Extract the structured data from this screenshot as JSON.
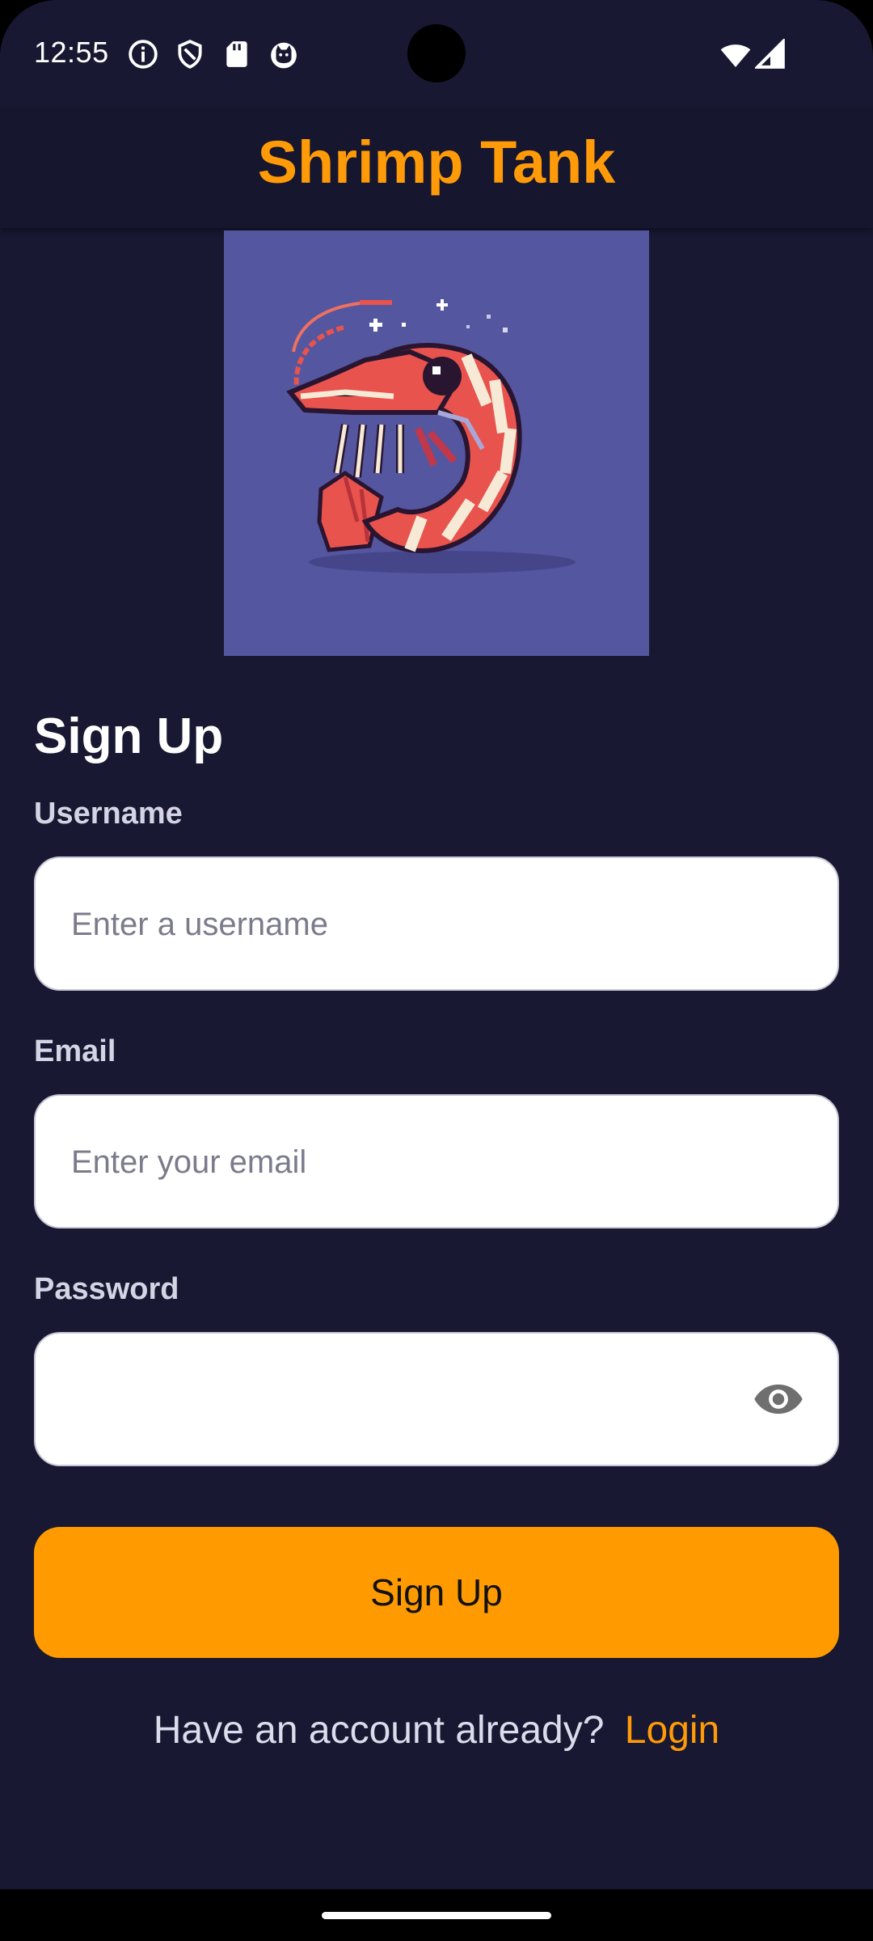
{
  "status_bar": {
    "time": "12:55",
    "icons": [
      "info-icon",
      "shield-icon",
      "sd-card-icon",
      "cat-icon",
      "wifi-icon",
      "signal-icon"
    ]
  },
  "app_bar": {
    "title": "Shrimp Tank"
  },
  "logo": {
    "icon": "shrimp-logo"
  },
  "form": {
    "heading": "Sign Up",
    "username": {
      "label": "Username",
      "placeholder": "Enter a username",
      "value": ""
    },
    "email": {
      "label": "Email",
      "placeholder": "Enter your email",
      "value": ""
    },
    "password": {
      "label": "Password",
      "placeholder": "",
      "value": "",
      "toggle_icon": "eye-icon"
    },
    "submit_label": "Sign Up"
  },
  "footer": {
    "prompt": "Have an account already?",
    "link_label": "Login"
  },
  "colors": {
    "background": "#181832",
    "accent": "#FF9A00",
    "logo_bg": "#5456A0"
  }
}
